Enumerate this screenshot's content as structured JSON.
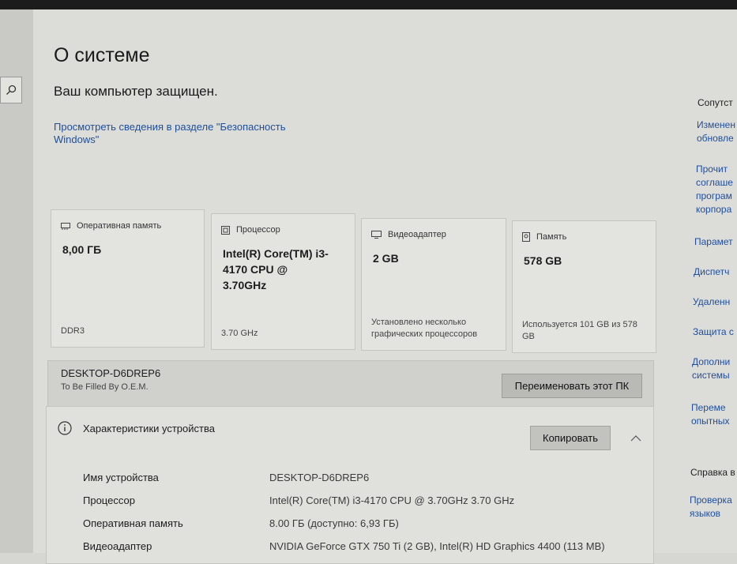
{
  "page": {
    "title": "О системе",
    "protection_status": "Ваш компьютер защищен.",
    "security_link": "Просмотреть сведения в разделе \"Безопасность Windows\""
  },
  "cards": [
    {
      "icon": "ram-icon",
      "title": "Оперативная память",
      "value": "8,00 ГБ",
      "footer": "DDR3"
    },
    {
      "icon": "cpu-icon",
      "title": "Процессор",
      "value": "Intel(R) Core(TM) i3-4170 CPU @ 3.70GHz",
      "footer": "3.70 GHz"
    },
    {
      "icon": "gpu-icon",
      "title": "Видеоадаптер",
      "value": "2 GB",
      "footer": "Установлено несколько графических процессоров"
    },
    {
      "icon": "storage-icon",
      "title": "Память",
      "value": "578 GB",
      "footer": "Используется 101 GB из 578 GB"
    }
  ],
  "device": {
    "name": "DESKTOP-D6DREP6",
    "manufacturer": "To Be Filled By O.E.M.",
    "rename_button": "Переименовать этот ПК"
  },
  "specs": {
    "title": "Характеристики устройства",
    "copy_button": "Копировать",
    "rows": [
      {
        "label": "Имя устройства",
        "value": "DESKTOP-D6DREP6"
      },
      {
        "label": "Процессор",
        "value": "Intel(R) Core(TM) i3-4170 CPU @ 3.70GHz   3.70 GHz"
      },
      {
        "label": "Оперативная память",
        "value": "8.00 ГБ (доступно: 6,93 ГБ)"
      },
      {
        "label": "Видеоадаптер",
        "value": "NVIDIA GeForce GTX 750 Ti (2 GB), Intel(R) HD Graphics 4400 (113 MB)"
      }
    ]
  },
  "right_panel": {
    "heading": "Сопутст",
    "link1": [
      "Изменен",
      "обновле"
    ],
    "link2": [
      "Прочит",
      "соглаше",
      "програм",
      "корпора"
    ],
    "link3": "Парамет",
    "link4": "Диспетч",
    "link5": "Удаленн",
    "link6": "Защита с",
    "link7": [
      "Дополни",
      "системы"
    ],
    "link8": [
      "Переме",
      "опытных"
    ],
    "help_heading": "Справка в",
    "link9": [
      "Проверка",
      "языков"
    ]
  },
  "colors": {
    "link": "#1f4f9c",
    "background": "#dcdcd9",
    "card": "#e3e3e0"
  }
}
